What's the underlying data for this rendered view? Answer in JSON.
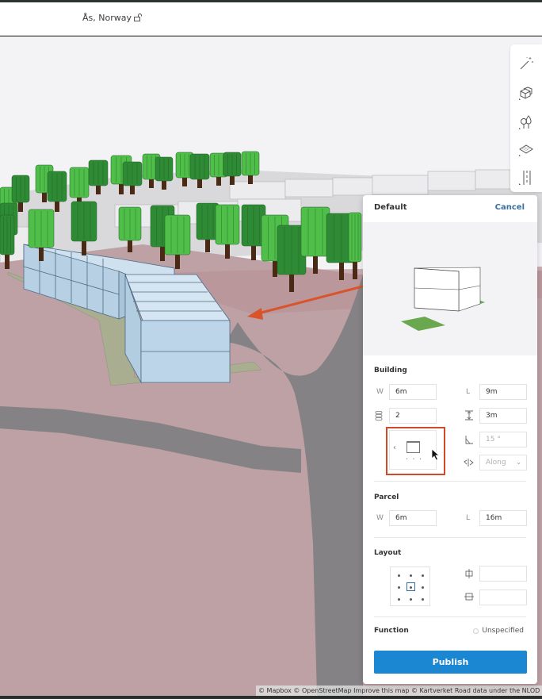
{
  "header": {
    "location": "Ås, Norway",
    "lock_icon": "unlock-icon"
  },
  "toolbar": {
    "tools": [
      {
        "name": "magic-wand",
        "icon": "magic-wand-icon"
      },
      {
        "name": "buildings",
        "icon": "buildings-icon"
      },
      {
        "name": "trees",
        "icon": "trees-icon"
      },
      {
        "name": "surface",
        "icon": "surface-icon"
      },
      {
        "name": "road",
        "icon": "road-icon"
      }
    ]
  },
  "panel": {
    "title": "Default",
    "cancel_label": "Cancel",
    "building": {
      "label": "Building",
      "width_label": "W",
      "width_value": "6m",
      "length_label": "L",
      "length_value": "9m",
      "floors_icon": "floors-icon",
      "floors_value": "2",
      "floor_height_icon": "floor-height-icon",
      "floor_height_value": "3m",
      "roof_angle_icon": "roof-angle-icon",
      "roof_angle_value": "15 °",
      "orientation_icon": "orientation-icon",
      "orientation_value": "Along",
      "shape_prev": "‹",
      "shape_pager": "• • •"
    },
    "parcel": {
      "label": "Parcel",
      "width_label": "W",
      "width_value": "6m",
      "length_label": "L",
      "length_value": "16m"
    },
    "layout": {
      "label": "Layout",
      "selected_anchor": "center",
      "horizontal_offset_value": "",
      "vertical_offset_value": ""
    },
    "function": {
      "label": "Function",
      "value": "Unspecified"
    },
    "publish_label": "Publish"
  },
  "map": {
    "attribution": "© Mapbox © OpenStreetMap Improve this map © Kartverket Road data under the NLOD l"
  },
  "annotation": {
    "highlight_color": "#d2492a",
    "arrow_color": "#d9542a"
  },
  "colors": {
    "accent": "#1b86d2",
    "link": "#3b6fa0",
    "ground": "#bfa2a5",
    "road": "#858285"
  }
}
